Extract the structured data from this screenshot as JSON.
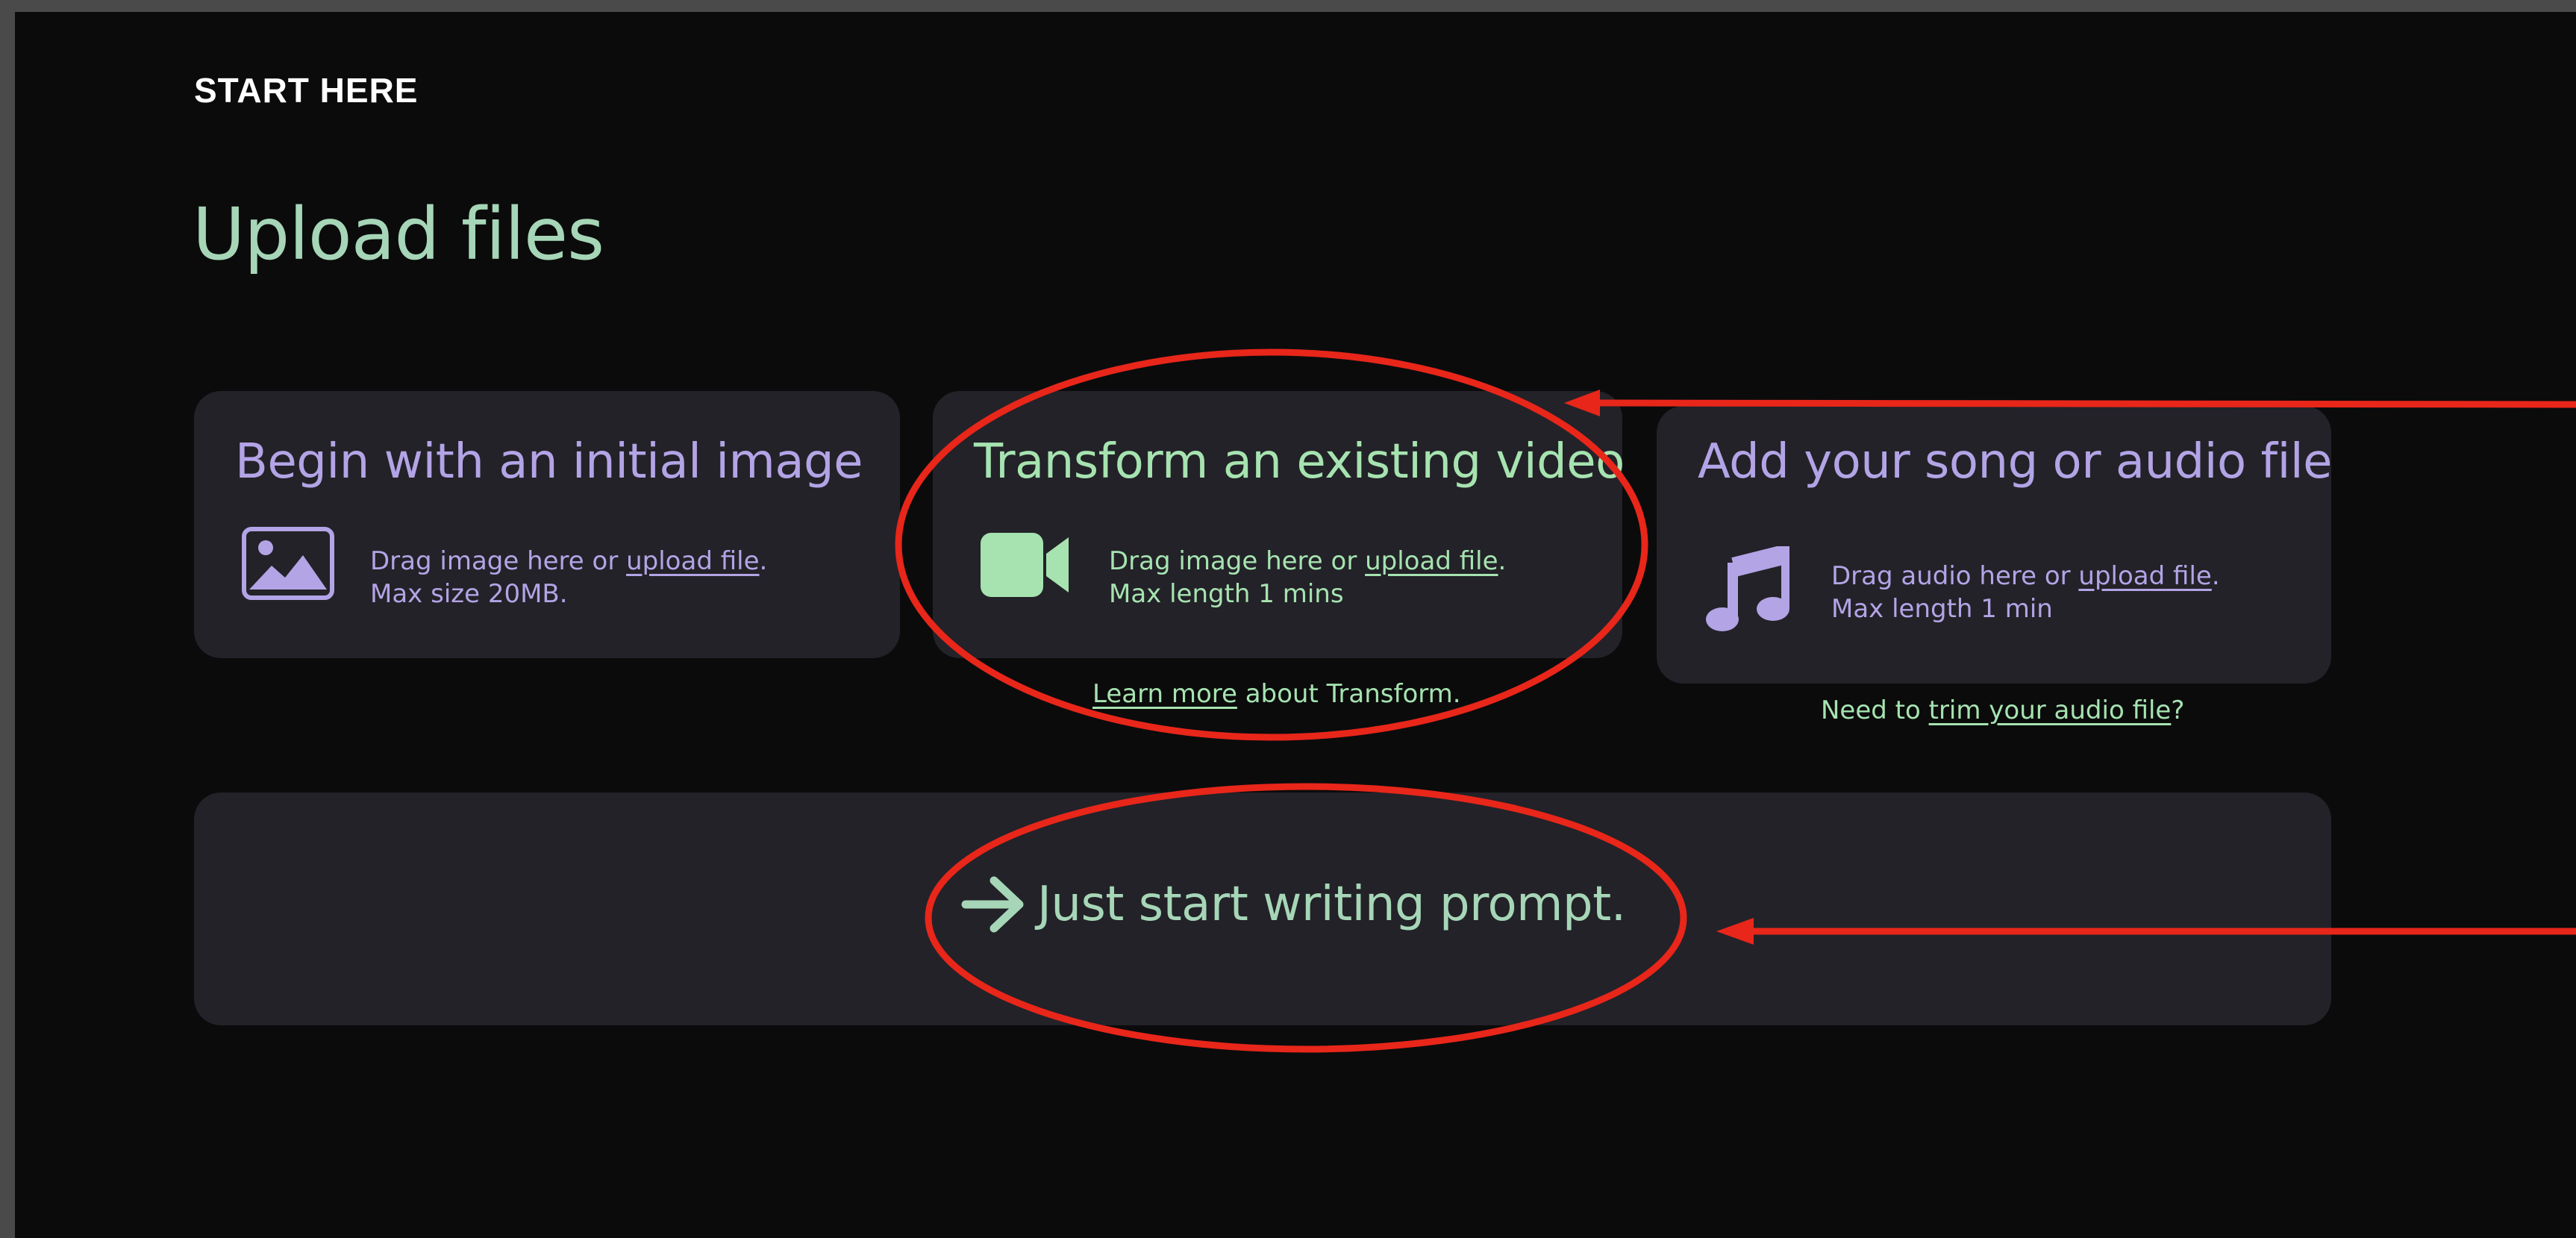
{
  "header": {
    "eyebrow": "START HERE",
    "title": "Upload files"
  },
  "cards": [
    {
      "title": "Begin with an initial image",
      "icon": "image-icon",
      "line1_prefix": "Drag image here or ",
      "link": "upload file",
      "line1_suffix": ".",
      "line2": "Max size 20MB."
    },
    {
      "title": "Transform an existing video",
      "icon": "video-camera-icon",
      "line1_prefix": "Drag image here or ",
      "link": "upload file",
      "line1_suffix": ".",
      "line2": "Max length 1 mins",
      "note_link": "Learn more",
      "note_suffix": " about Transform."
    },
    {
      "title": "Add your song or audio file",
      "icon": "music-note-icon",
      "line1_prefix": "Drag audio here or ",
      "link": "upload file",
      "line1_suffix": ".",
      "line2": "Max length 1 min",
      "note_prefix": "Need to ",
      "note_link": "trim your audio file",
      "note_suffix": "?"
    }
  ],
  "prompt": {
    "icon": "arrow-right-icon",
    "label": "Just start writing prompt."
  },
  "annotations": {
    "color": "#e8261a",
    "marks": [
      "red-ellipse-transform-video",
      "red-ellipse-prompt",
      "red-arrow-top",
      "red-arrow-bottom"
    ]
  },
  "colors": {
    "background": "#0b0b0c",
    "card": "#232228",
    "purple_accent": "#b3a4e6",
    "green_accent": "#a6e3b0",
    "title_green": "#a6d6b7"
  }
}
